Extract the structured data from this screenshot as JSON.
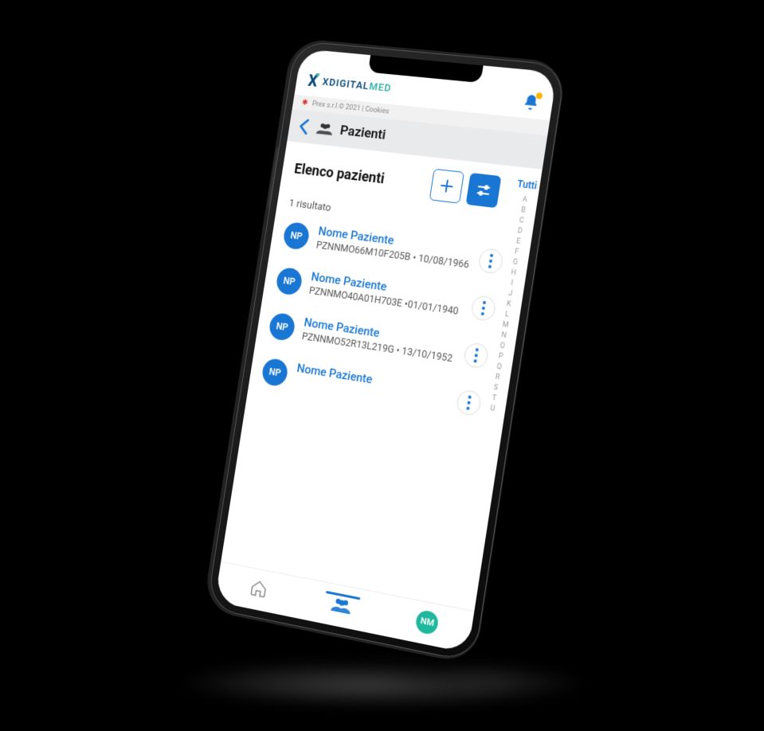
{
  "brand": {
    "x": "X",
    "pre": "XDIGITAL",
    "suf": "MED"
  },
  "meta": {
    "text": "Prex s.r.l.© 2021  |  Cookies"
  },
  "nav": {
    "title": "Pazienti"
  },
  "list": {
    "title": "Elenco pazienti",
    "result_count": "1 risultato"
  },
  "alpha": {
    "all_label": "Tutti",
    "letters": [
      "A",
      "B",
      "C",
      "D",
      "E",
      "F",
      "G",
      "H",
      "I",
      "J",
      "K",
      "L",
      "M",
      "N",
      "O",
      "P",
      "Q",
      "R",
      "S",
      "T",
      "U"
    ]
  },
  "patients": [
    {
      "initials": "NP",
      "name": "Nome Paziente",
      "meta": "PZNNMO66M10F205B • 10/08/1966"
    },
    {
      "initials": "NP",
      "name": "Nome Paziente",
      "meta": "PZNNMO40A01H703E •01/01/1940"
    },
    {
      "initials": "NP",
      "name": "Nome Paziente",
      "meta": "PZNNMO52R13L219G • 13/10/1952"
    },
    {
      "initials": "NP",
      "name": "Nome Paziente",
      "meta": ""
    }
  ],
  "tabbar": {
    "profile_initials": "NM"
  }
}
